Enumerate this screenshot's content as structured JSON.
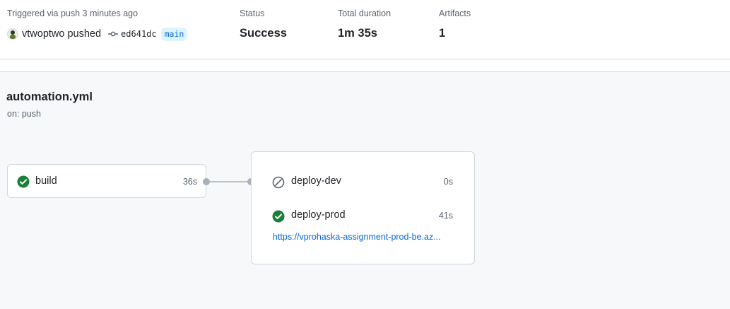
{
  "summary": {
    "trigger_text": "Triggered via push 3 minutes ago",
    "actor": "vtwoptwo pushed",
    "commit_sha": "ed641dc",
    "branch": "main",
    "status_label": "Status",
    "status_value": "Success",
    "duration_label": "Total duration",
    "duration_value": "1m 35s",
    "artifacts_label": "Artifacts",
    "artifacts_value": "1"
  },
  "workflow": {
    "name": "automation.yml",
    "trigger": "on: push"
  },
  "jobs": [
    {
      "name": "build",
      "duration": "36s",
      "status": "success"
    },
    {
      "name": "deploy-dev",
      "duration": "0s",
      "status": "skipped"
    },
    {
      "name": "deploy-prod",
      "duration": "41s",
      "status": "success",
      "environment_url": "https://vprohaska-assignment-prod-be.az..."
    }
  ],
  "colors": {
    "success": "#1a7f37",
    "skipped": "#59636e",
    "link": "#0969da"
  },
  "icons": {
    "success": "check-circle-fill-icon",
    "skipped": "skip-icon",
    "commit": "git-commit-icon"
  }
}
